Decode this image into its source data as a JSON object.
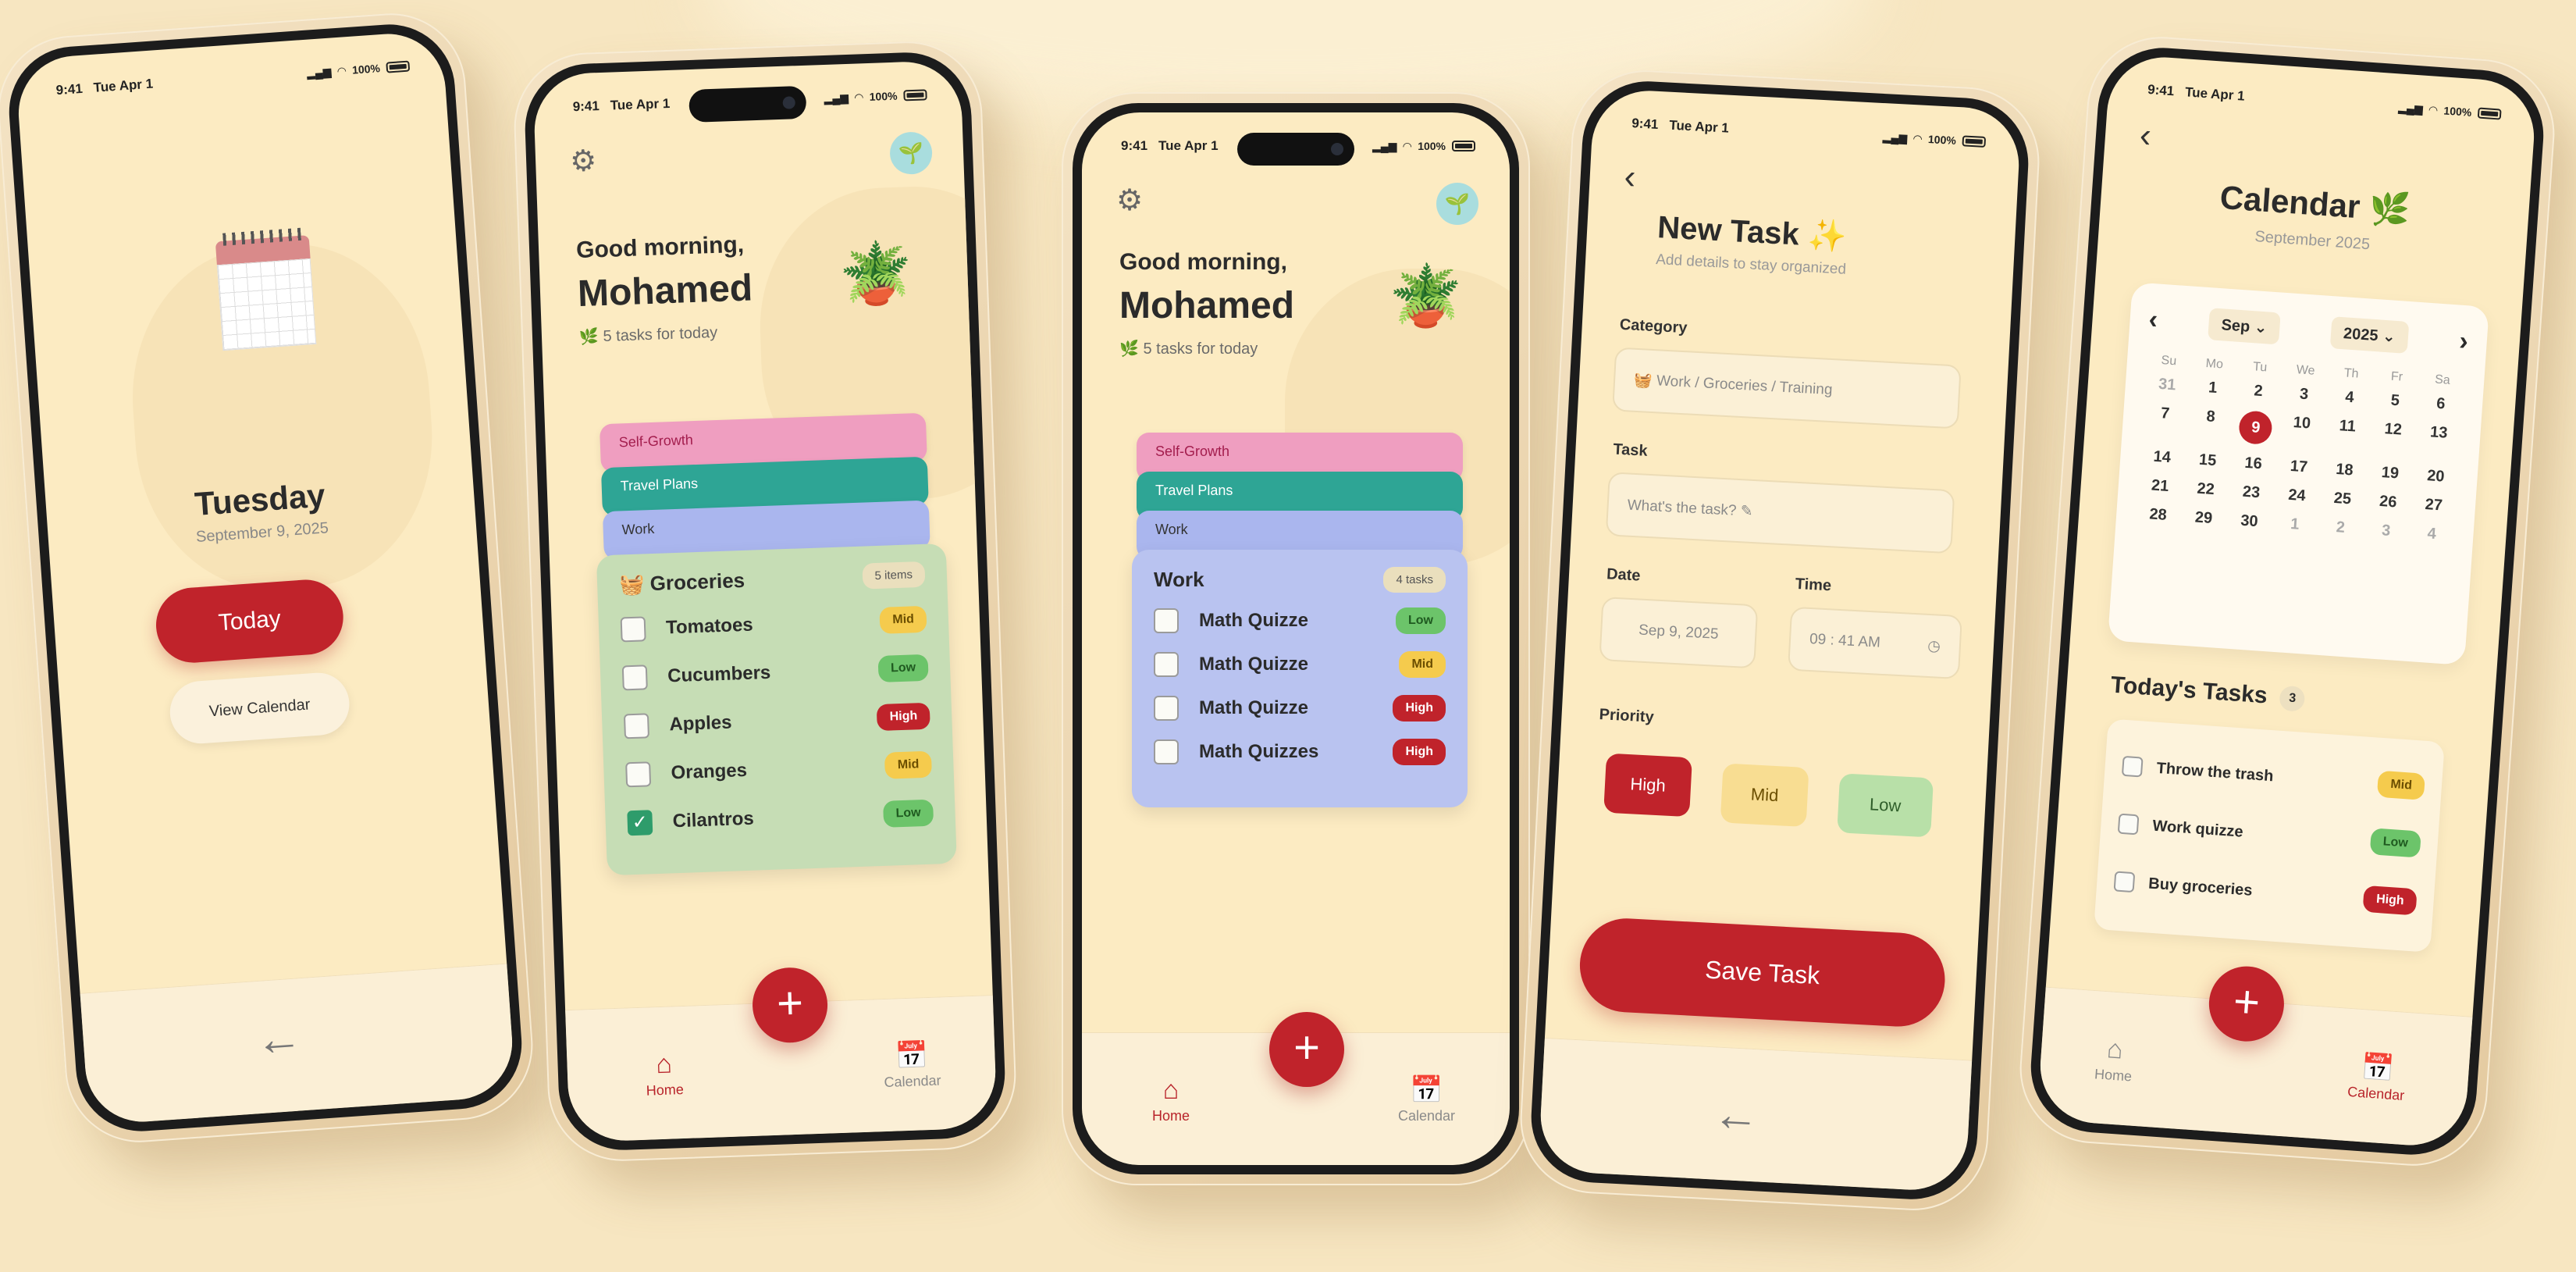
{
  "status": {
    "time": "9:41",
    "date": "Tue Apr 1",
    "battery": "100%"
  },
  "colors": {
    "accent": "#c0232b",
    "background": "#fcebc2",
    "mid": "#f5cb4d",
    "low": "#6cc46a"
  },
  "splash": {
    "day": "Tuesday",
    "date": "September 9, 2025",
    "today_button": "Today",
    "view_calendar_button": "View Calendar",
    "icon": "calendar-pad-icon"
  },
  "home_groceries": {
    "greeting": "Good morning,",
    "name": "Mohamed",
    "tasks_count": "5 tasks for today",
    "stack_tabs": [
      "Self-Growth",
      "Travel Plans",
      "Work"
    ],
    "card": {
      "title": "Groceries",
      "count": "5 items",
      "items": [
        {
          "name": "Tomatoes",
          "priority": "Mid",
          "checked": false
        },
        {
          "name": "Cucumbers",
          "priority": "Low",
          "checked": false
        },
        {
          "name": "Apples",
          "priority": "High",
          "checked": false
        },
        {
          "name": "Oranges",
          "priority": "Mid",
          "checked": false
        },
        {
          "name": "Cilantros",
          "priority": "Low",
          "checked": true
        }
      ]
    },
    "nav": {
      "home": "Home",
      "calendar": "Calendar"
    }
  },
  "home_work": {
    "greeting": "Good morning,",
    "name": "Mohamed",
    "tasks_count": "5 tasks for today",
    "stack_tabs": [
      "Self-Growth",
      "Travel Plans",
      "Work"
    ],
    "card": {
      "title": "Work",
      "count": "4 tasks",
      "items": [
        {
          "name": "Math Quizze",
          "priority": "Low"
        },
        {
          "name": "Math Quizze",
          "priority": "Mid"
        },
        {
          "name": "Math Quizze",
          "priority": "High"
        },
        {
          "name": "Math Quizzes",
          "priority": "High"
        }
      ]
    },
    "nav": {
      "home": "Home",
      "calendar": "Calendar"
    }
  },
  "new_task": {
    "title": "New Task ✨",
    "subtitle": "Add details to stay organized",
    "category_label": "Category",
    "category_placeholder": "Work / Groceries / Training",
    "task_label": "Task",
    "task_placeholder": "What's the task? ✎",
    "date_label": "Date",
    "date_value": "Sep 9, 2025",
    "time_label": "Time",
    "time_value": "09 : 41 AM",
    "priority_label": "Priority",
    "priorities": [
      "High",
      "Mid",
      "Low"
    ],
    "save_button": "Save Task"
  },
  "calendar": {
    "title": "Calendar 🌿",
    "subtitle": "September 2025",
    "month_select": "Sep ⌄",
    "year_select": "2025 ⌄",
    "weekdays": [
      "Su",
      "Mo",
      "Tu",
      "We",
      "Th",
      "Fr",
      "Sa"
    ],
    "days": [
      "31",
      "1",
      "2",
      "3",
      "4",
      "5",
      "6",
      "7",
      "8",
      "9",
      "10",
      "11",
      "12",
      "13",
      "14",
      "15",
      "16",
      "17",
      "18",
      "19",
      "20",
      "21",
      "22",
      "23",
      "24",
      "25",
      "26",
      "27",
      "28",
      "29",
      "30",
      "1",
      "2",
      "3",
      "4"
    ],
    "selected_day": "9",
    "todays_tasks_title": "Today's Tasks",
    "todays_tasks_count": "3",
    "tasks": [
      {
        "name": "Throw the trash",
        "priority": "Mid"
      },
      {
        "name": "Work quizze",
        "priority": "Low"
      },
      {
        "name": "Buy groceries",
        "priority": "High"
      }
    ],
    "nav": {
      "home": "Home",
      "calendar": "Calendar"
    }
  }
}
